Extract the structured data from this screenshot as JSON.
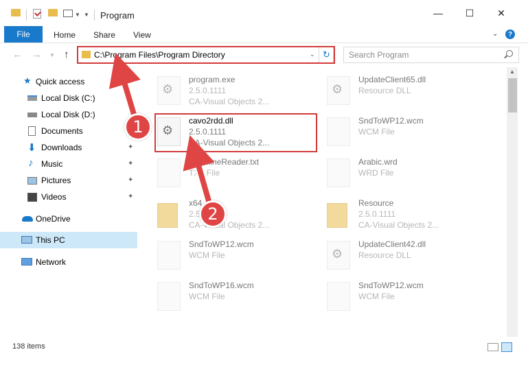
{
  "window": {
    "title": "Program",
    "minimize_icon": "—",
    "maximize_icon": "☐",
    "close_icon": "✕"
  },
  "ribbon": {
    "file": "File",
    "home": "Home",
    "share": "Share",
    "view": "View",
    "help": "?"
  },
  "nav": {
    "back": "←",
    "forward": "→",
    "up": "↑",
    "address": "C:\\Program Files\\Program Directory",
    "search_placeholder": "Search Program",
    "refresh": "↻"
  },
  "sidebar": {
    "items": [
      {
        "label": "Quick access",
        "pinned": false
      },
      {
        "label": "Local Disk (C:)",
        "pinned": true
      },
      {
        "label": "Local Disk (D:)",
        "pinned": true
      },
      {
        "label": "Documents",
        "pinned": true
      },
      {
        "label": "Downloads",
        "pinned": true
      },
      {
        "label": "Music",
        "pinned": true
      },
      {
        "label": "Pictures",
        "pinned": true
      },
      {
        "label": "Videos",
        "pinned": true
      },
      {
        "label": "OneDrive",
        "pinned": false
      },
      {
        "label": "This PC",
        "pinned": false
      },
      {
        "label": "Network",
        "pinned": false
      }
    ]
  },
  "files": [
    {
      "name": "program.exe",
      "line2": "2.5.0.1111",
      "line3": "CA-Visual Objects 2...",
      "icon": "gear"
    },
    {
      "name": "UpdateClient65.dll",
      "line2": "Resource DLL",
      "line3": "",
      "icon": "gear"
    },
    {
      "name": "cavo2rdd.dll",
      "line2": "2.5.0.1111",
      "line3": "CA-Visual Objects 2...",
      "icon": "gear"
    },
    {
      "name": "SndToWP12.wcm",
      "line2": "WCM File",
      "line3": "",
      "icon": "doc"
    },
    {
      "name": "ReadlineReader.txt",
      "line2": "TXT File",
      "line3": "",
      "icon": "doc"
    },
    {
      "name": "Arabic.wrd",
      "line2": "WRD File",
      "line3": "",
      "icon": "doc"
    },
    {
      "name": "x64",
      "line2": "2.5.0.1111",
      "line3": "CA-Visual Objects 2...",
      "icon": "folder"
    },
    {
      "name": "Resource",
      "line2": "2.5.0.1111",
      "line3": "CA-Visual Objects 2...",
      "icon": "folder"
    },
    {
      "name": "SndToWP12.wcm",
      "line2": "WCM File",
      "line3": "",
      "icon": "doc"
    },
    {
      "name": "UpdateClient42.dll",
      "line2": "Resource DLL",
      "line3": "",
      "icon": "gear"
    },
    {
      "name": "SndToWP16.wcm",
      "line2": "WCM File",
      "line3": "",
      "icon": "doc"
    },
    {
      "name": "SndToWP12.wcm",
      "line2": "WCM File",
      "line3": "",
      "icon": "doc"
    }
  ],
  "status": {
    "count": "138 items"
  },
  "callouts": {
    "one": "1",
    "two": "2"
  },
  "colors": {
    "accent": "#1979ca",
    "highlight": "#d23a3a",
    "callout": "#e04545"
  }
}
